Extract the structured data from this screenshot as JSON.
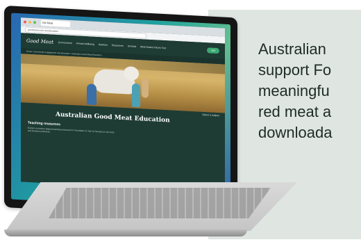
{
  "blurb": {
    "lines": [
      "Australian",
      "support Fo",
      "meaningfu",
      "red meat a",
      "downloada"
    ]
  },
  "browser": {
    "tab_title": "Gd Meat",
    "url": "goodmeat.com.au/education"
  },
  "site": {
    "logo": "Good Meat",
    "nav": [
      "Environment",
      "Animal wellbeing",
      "Nutrition",
      "Resources",
      "Schools",
      "Meat Mates Voices Tour"
    ],
    "nav_button": "Get",
    "breadcrumb": "Home / Community engagement and education / Australian Good Meat Education",
    "hero_subject": "Select a subject",
    "heading": "Australian Good Meat Education",
    "subheading": "Teaching resources",
    "paragraph": "Explore curriculum-aligned teaching resources for Foundation to Year 10 focused on red meat and livestock production."
  },
  "colors": {
    "panel_bg": "#dfe6e2",
    "site_bg": "#1e3c34",
    "accent": "#3aa873"
  }
}
